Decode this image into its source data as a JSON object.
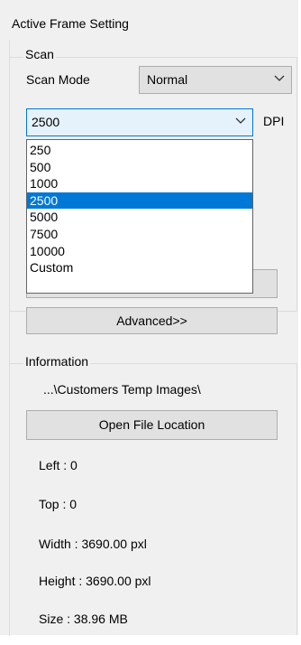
{
  "window": {
    "title": "Active Frame Setting"
  },
  "scan": {
    "group_label": "Scan",
    "mode_label": "Scan Mode",
    "mode_value": "Normal",
    "dpi_value": "2500",
    "dpi_unit": "DPI",
    "dpi_options": [
      {
        "label": "250",
        "selected": false
      },
      {
        "label": "500",
        "selected": false
      },
      {
        "label": "1000",
        "selected": false
      },
      {
        "label": "2500",
        "selected": true
      },
      {
        "label": "5000",
        "selected": false
      },
      {
        "label": "7500",
        "selected": false
      },
      {
        "label": "10000",
        "selected": false
      },
      {
        "label": "Custom",
        "selected": false
      }
    ],
    "advanced_label": "Advanced>>"
  },
  "information": {
    "group_label": "Information",
    "path": "...\\Customers Temp Images\\",
    "open_location_label": "Open File Location",
    "left": "Left : 0",
    "top": "Top : 0",
    "width": "Width : 3690.00 pxl",
    "height": "Height : 3690.00 pxl",
    "size": "Size : 38.96 MB"
  },
  "colors": {
    "accent": "#0078d7",
    "panel_bg": "#f0f0f0",
    "button_bg": "#e1e1e1"
  }
}
